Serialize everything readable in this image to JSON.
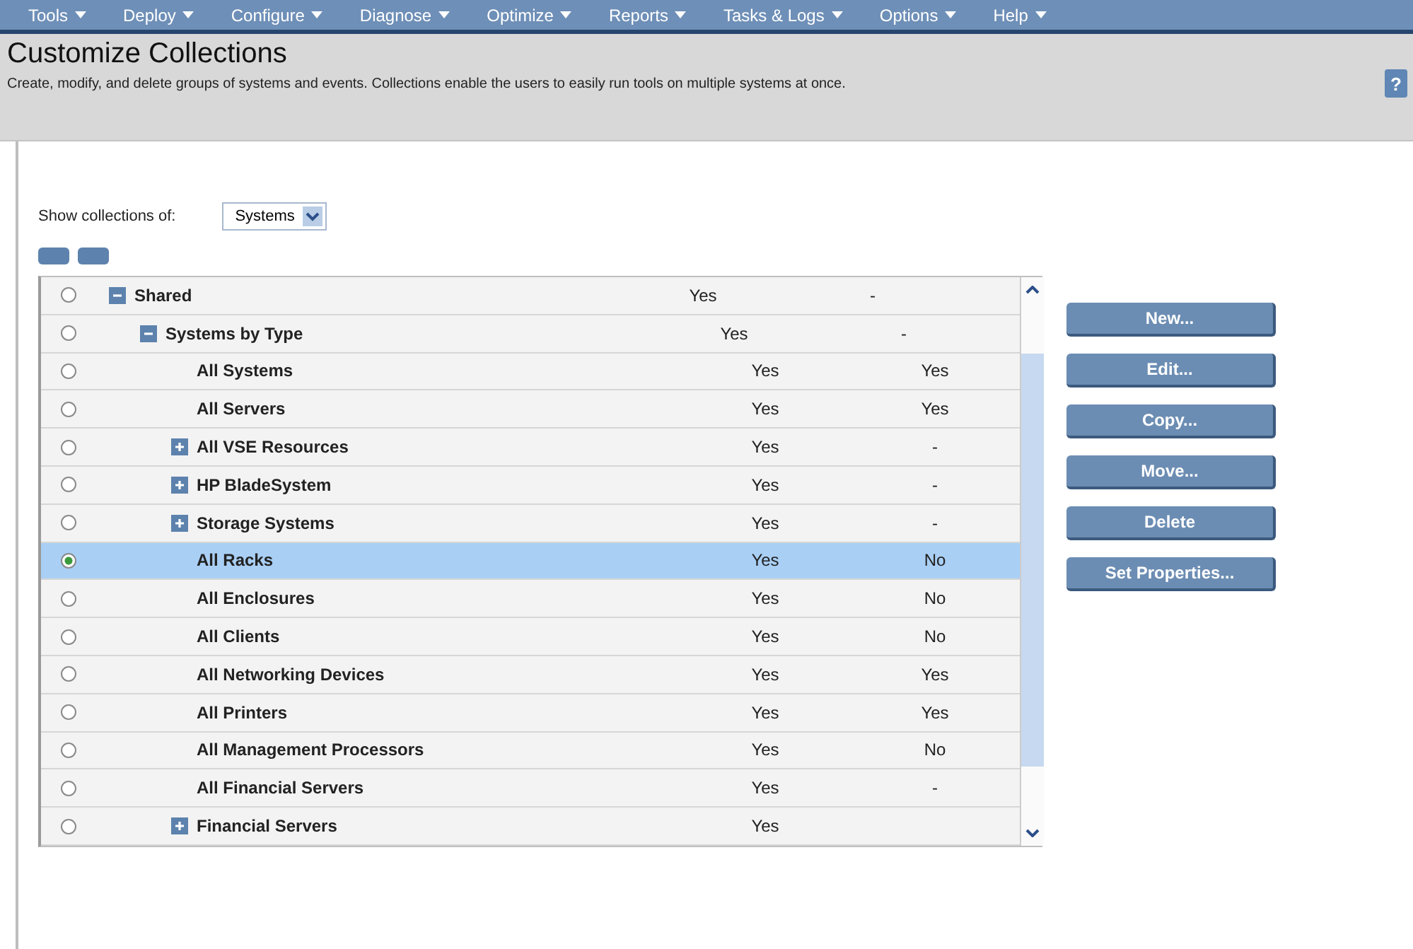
{
  "menu": [
    {
      "label": "Tools"
    },
    {
      "label": "Deploy"
    },
    {
      "label": "Configure"
    },
    {
      "label": "Diagnose"
    },
    {
      "label": "Optimize"
    },
    {
      "label": "Reports"
    },
    {
      "label": "Tasks & Logs"
    },
    {
      "label": "Options"
    },
    {
      "label": "Help"
    }
  ],
  "header": {
    "title": "Customize Collections",
    "description": "Create, modify, and delete groups of systems and events. Collections enable the users to easily run tools on multiple systems at once.",
    "help": "?"
  },
  "filter": {
    "label": "Show collections of:",
    "value": "Systems"
  },
  "tree": [
    {
      "label": "Shared",
      "expanded": true,
      "selected": false,
      "column_2": "Yes",
      "column_3": "-",
      "children": [
        {
          "label": "Systems by Type",
          "expanded": true,
          "selected": false,
          "column_2": "Yes",
          "column_3": "-",
          "children": [
            {
              "label": "All Systems",
              "selected": false,
              "column_2": "Yes",
              "column_3": "Yes"
            },
            {
              "label": "All Servers",
              "selected": false,
              "column_2": "Yes",
              "column_3": "Yes"
            },
            {
              "label": "All VSE Resources",
              "expanded": false,
              "selected": false,
              "column_2": "Yes",
              "column_3": "-"
            },
            {
              "label": "HP BladeSystem",
              "expanded": false,
              "selected": false,
              "column_2": "Yes",
              "column_3": "-"
            },
            {
              "label": "Storage Systems",
              "expanded": false,
              "selected": false,
              "column_2": "Yes",
              "column_3": "-"
            },
            {
              "label": "All Racks",
              "selected": true,
              "column_2": "Yes",
              "column_3": "No"
            },
            {
              "label": "All Enclosures",
              "selected": false,
              "column_2": "Yes",
              "column_3": "No"
            },
            {
              "label": "All Clients",
              "selected": false,
              "column_2": "Yes",
              "column_3": "No"
            },
            {
              "label": "All Networking Devices",
              "selected": false,
              "column_2": "Yes",
              "column_3": "Yes"
            },
            {
              "label": "All Printers",
              "selected": false,
              "column_2": "Yes",
              "column_3": "Yes"
            },
            {
              "label": "All Management Processors",
              "selected": false,
              "column_2": "Yes",
              "column_3": "No"
            },
            {
              "label": "All Financial Servers",
              "selected": false,
              "column_2": "Yes",
              "column_3": "-"
            },
            {
              "label": "Financial Servers",
              "expanded": false,
              "selected": false,
              "column_2": "Yes"
            }
          ]
        }
      ]
    }
  ],
  "actions": [
    {
      "label": "New..."
    },
    {
      "label": "Edit..."
    },
    {
      "label": "Copy..."
    },
    {
      "label": "Move..."
    },
    {
      "label": "Delete"
    },
    {
      "label": "Set Properties..."
    }
  ]
}
